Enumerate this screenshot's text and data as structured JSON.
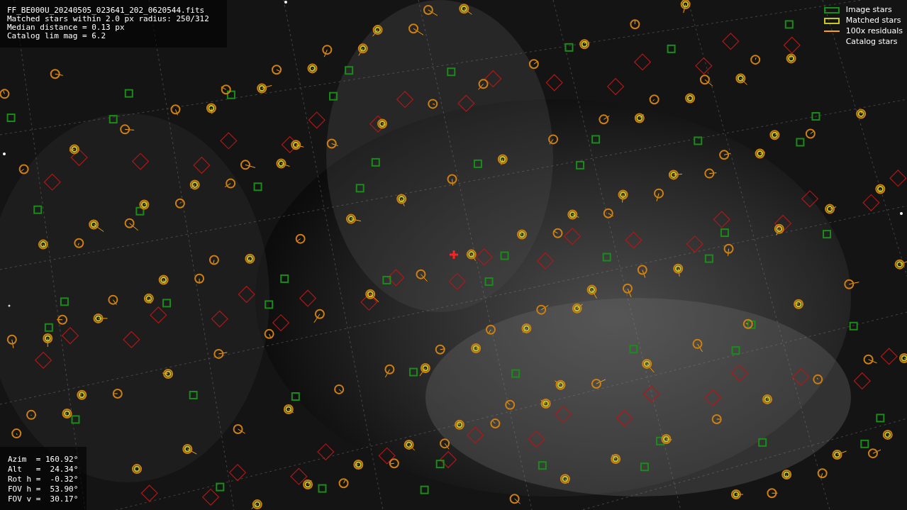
{
  "info_box": {
    "lines": [
      "FF_BE000U_20240505_023641_202_0620544.fits",
      "Matched stars within 2.0 px radius: 250/312",
      "Median distance = 0.13 px",
      "Catalog lim mag = 6.2"
    ]
  },
  "legend": [
    {
      "label": "Image stars",
      "color": "#1a8c1a"
    },
    {
      "kind": "matched",
      "label": "Matched stars",
      "color": "#c8c81e"
    },
    {
      "kind": "residual",
      "label": "100x residuals",
      "color": "#ffa500"
    },
    {
      "kind": "catalog",
      "label": "Catalog stars"
    }
  ],
  "pointing_box": {
    "lines": [
      "Azim  = 160.92°",
      "Alt   =  24.34°",
      "Rot h =  -0.32°",
      "FOV h =  53.90°",
      "FOV v =  30.17°"
    ]
  }
}
